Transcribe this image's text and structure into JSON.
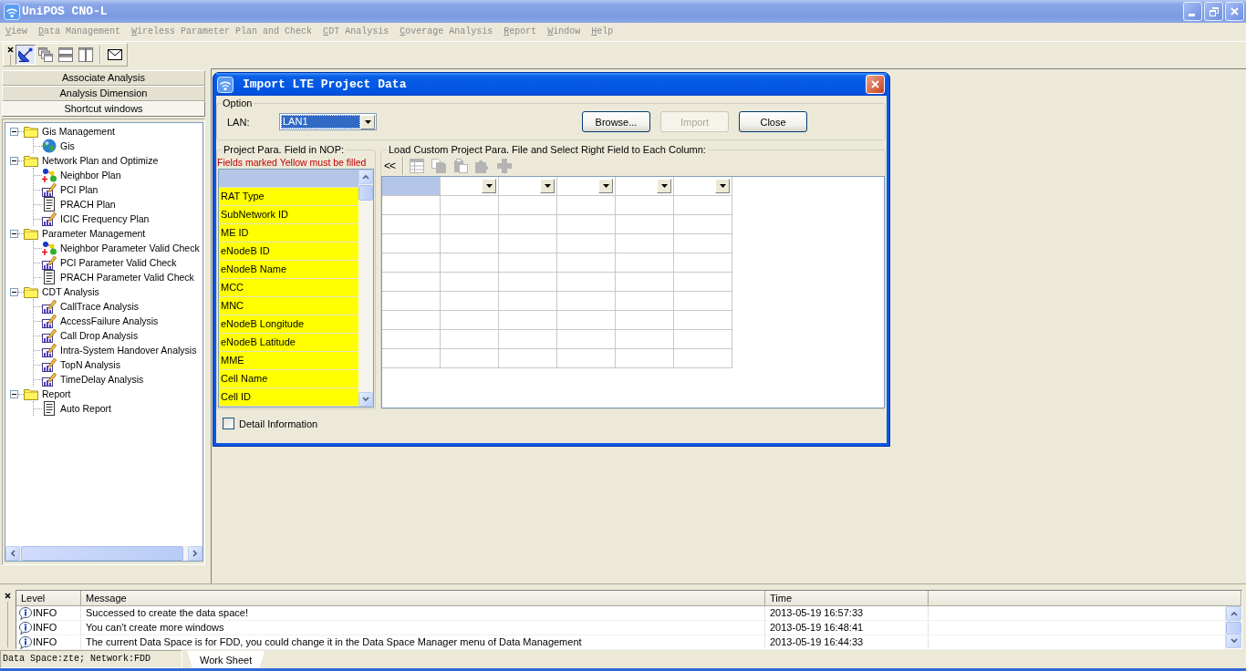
{
  "window": {
    "title": "UniPOS CNO-L"
  },
  "menu": [
    {
      "label": "View",
      "disabled": true
    },
    {
      "label": "Data Management",
      "disabled": true
    },
    {
      "label": "Wireless Parameter Plan and Check",
      "disabled": true
    },
    {
      "label": "CDT Analysis",
      "disabled": true
    },
    {
      "label": "Coverage Analysis",
      "disabled": true
    },
    {
      "label": "Report",
      "disabled": true
    },
    {
      "label": "Window",
      "disabled": true
    },
    {
      "label": "Help",
      "disabled": true
    }
  ],
  "toolbar": [
    {
      "kind": "dish",
      "selected": true
    },
    {
      "kind": "cascade",
      "selected": false
    },
    {
      "kind": "tile-horizontal",
      "selected": false
    },
    {
      "kind": "tile-vertical",
      "selected": false
    },
    {
      "kind": "mail",
      "selected": false
    }
  ],
  "sidebar": {
    "sections": [
      {
        "label": "Associate Analysis",
        "selected": false
      },
      {
        "label": "Analysis Dimension",
        "selected": false
      },
      {
        "label": "Shortcut windows",
        "selected": true
      }
    ],
    "tree": [
      {
        "label": "Gis Management",
        "kind": "folder",
        "expanded": true,
        "children": [
          {
            "label": "Gis",
            "kind": "globe"
          }
        ]
      },
      {
        "label": "Network Plan and Optimize",
        "kind": "folder",
        "expanded": true,
        "children": [
          {
            "label": "Neighbor Plan",
            "kind": "network"
          },
          {
            "label": "PCI Plan",
            "kind": "chart"
          },
          {
            "label": "PRACH Plan",
            "kind": "form"
          },
          {
            "label": "ICIC Frequency Plan",
            "kind": "chart"
          }
        ]
      },
      {
        "label": "Parameter Management",
        "kind": "folder",
        "expanded": true,
        "children": [
          {
            "label": "Neighbor Parameter Valid Check",
            "kind": "network"
          },
          {
            "label": "PCI Parameter Valid Check",
            "kind": "chart"
          },
          {
            "label": "PRACH Parameter Valid Check",
            "kind": "form"
          }
        ]
      },
      {
        "label": "CDT Analysis",
        "kind": "folder",
        "expanded": true,
        "children": [
          {
            "label": "CallTrace Analysis",
            "kind": "chart"
          },
          {
            "label": "AccessFailure Analysis",
            "kind": "chart"
          },
          {
            "label": "Call Drop Analysis",
            "kind": "chart"
          },
          {
            "label": "Intra-System Handover Analysis",
            "kind": "chart"
          },
          {
            "label": "TopN Analysis",
            "kind": "chart"
          },
          {
            "label": "TimeDelay Analysis",
            "kind": "chart"
          }
        ]
      },
      {
        "label": "Report",
        "kind": "folder",
        "expanded": true,
        "children": [
          {
            "label": "Auto Report",
            "kind": "form"
          }
        ]
      }
    ]
  },
  "dialog": {
    "title": "Import LTE Project Data",
    "option": {
      "legend": "Option",
      "lan_label": "LAN:",
      "lan_value": "LAN1"
    },
    "buttons": [
      {
        "label": "Browse...",
        "disabled": false
      },
      {
        "label": "Import",
        "disabled": true
      },
      {
        "label": "Close",
        "disabled": false
      }
    ],
    "fields": {
      "legend": "Project Para. Field in NOP:",
      "note": "Fields marked Yellow must be filled",
      "items": [
        {
          "selected": true
        },
        {
          "label": "RAT Type",
          "required": true,
          "selected": false
        },
        {
          "label": "SubNetwork ID",
          "required": true,
          "selected": false
        },
        {
          "label": "ME ID",
          "required": true,
          "selected": false
        },
        {
          "label": "eNodeB ID",
          "required": true,
          "selected": false
        },
        {
          "label": "eNodeB Name",
          "required": true,
          "selected": false
        },
        {
          "label": "MCC",
          "required": true,
          "selected": false
        },
        {
          "label": "MNC",
          "required": true,
          "selected": false
        },
        {
          "label": "eNodeB Longitude",
          "required": true,
          "selected": false
        },
        {
          "label": "eNodeB Latitude",
          "required": true,
          "selected": false
        },
        {
          "label": "MME",
          "required": true,
          "selected": false
        },
        {
          "label": "Cell Name",
          "required": true,
          "selected": false
        },
        {
          "label": "Cell ID",
          "required": true,
          "selected": false
        }
      ]
    },
    "mapping": {
      "legend": "Load Custom Project Para. File and Select Right Field to Each Column:",
      "toolbar": [
        {
          "kind": "text",
          "label": "<<",
          "disabled": false
        },
        {
          "kind": "table",
          "disabled": true
        },
        {
          "kind": "copy",
          "disabled": true
        },
        {
          "kind": "paste",
          "disabled": true
        },
        {
          "kind": "puzzle-arrow",
          "disabled": true
        },
        {
          "kind": "puzzle",
          "disabled": true
        }
      ],
      "columns": [
        {
          "kind": "index",
          "selected": true
        },
        {
          "kind": "dropdown",
          "selected": false
        },
        {
          "kind": "dropdown",
          "selected": false
        },
        {
          "kind": "dropdown",
          "selected": false
        },
        {
          "kind": "dropdown",
          "selected": false
        },
        {
          "kind": "dropdown",
          "selected": false
        }
      ]
    },
    "detail": {
      "label": "Detail Information",
      "checked": false
    }
  },
  "log": {
    "columns": [
      "Level",
      "Message",
      "Time"
    ],
    "rows": [
      {
        "level": "INFO",
        "message": "Successed to create the data space!",
        "time": "2013-05-19 16:57:33"
      },
      {
        "level": "INFO",
        "message": "You can't create more windows",
        "time": "2013-05-19 16:48:41"
      },
      {
        "level": "INFO",
        "message": "The current Data Space is for FDD, you could change it in the Data Space Manager menu of Data Management",
        "time": "2013-05-19 16:44:33"
      }
    ]
  },
  "status_bar": {
    "text": "Data Space:zte; Network:FDD",
    "tabs": [
      {
        "label": "Work Sheet",
        "selected": true
      }
    ]
  }
}
